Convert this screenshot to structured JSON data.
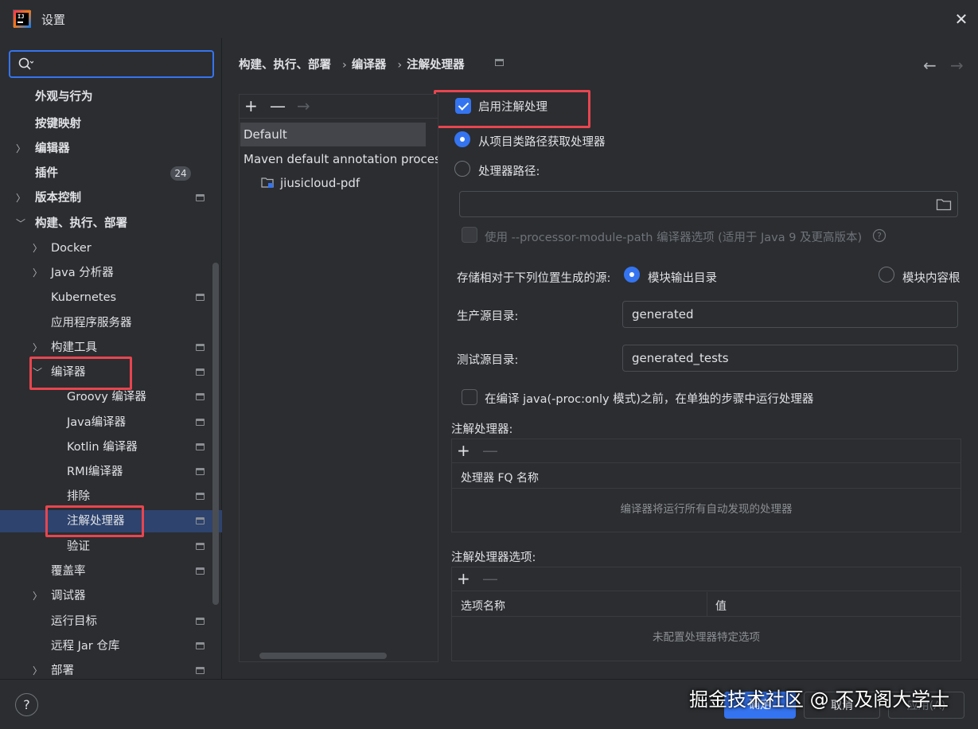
{
  "window": {
    "title": "设置",
    "close_icon": "close-icon"
  },
  "sidebar": {
    "search_placeholder": "",
    "items": [
      {
        "label": "外观与行为",
        "bold": true
      },
      {
        "label": "按键映射",
        "bold": true
      },
      {
        "label": "编辑器",
        "bold": true
      },
      {
        "label": "插件",
        "bold": true,
        "badge": "24"
      },
      {
        "label": "版本控制",
        "bold": true
      },
      {
        "label": "构建、执行、部署",
        "bold": true
      },
      {
        "label": "Docker"
      },
      {
        "label": "Java 分析器"
      },
      {
        "label": "Kubernetes"
      },
      {
        "label": "应用程序服务器"
      },
      {
        "label": "构建工具"
      },
      {
        "label": "编译器"
      },
      {
        "label": "Groovy 编译器"
      },
      {
        "label": "Java编译器"
      },
      {
        "label": "Kotlin 编译器"
      },
      {
        "label": "RMI编译器"
      },
      {
        "label": "排除"
      },
      {
        "label": "注解处理器",
        "selected": true
      },
      {
        "label": "验证"
      },
      {
        "label": "覆盖率"
      },
      {
        "label": "调试器"
      },
      {
        "label": "运行目标"
      },
      {
        "label": "远程 Jar 仓库"
      },
      {
        "label": "部署"
      }
    ]
  },
  "breadcrumb": [
    "构建、执行、部署",
    "编译器",
    "注解处理器"
  ],
  "profiles": {
    "default": "Default",
    "maven": "Maven default annotation processors profile",
    "module": "jiusicloud-pdf"
  },
  "form": {
    "enable_label": "启用注解处理",
    "enable_checked": true,
    "from_classpath_label": "从项目类路径获取处理器",
    "processor_path_label": "处理器路径:",
    "processor_path_value": "",
    "module_path_option": "使用 --processor-module-path 编译器选项 (适用于 Java 9 及更高版本)",
    "store_label": "存储相对于下列位置生成的源:",
    "store_option_output": "模块输出目录",
    "store_option_content_root": "模块内容根",
    "prod_dir_label": "生产源目录:",
    "prod_dir_value": "generated",
    "test_dir_label": "测试源目录:",
    "test_dir_value": "generated_tests",
    "separate_step_label": "在编译 java(-proc:only 模式)之前，在单独的步骤中运行处理器",
    "processors_title": "注解处理器:",
    "processors_col": "处理器 FQ 名称",
    "processors_empty": "编译器将运行所有自动发现的处理器",
    "options_title": "注解处理器选项:",
    "options_col_name": "选项名称",
    "options_col_value": "值",
    "options_empty": "未配置处理器特定选项"
  },
  "buttons": {
    "ok": "确定",
    "cancel": "取消",
    "apply": "应用(A)",
    "help": "?"
  },
  "watermark": "掘金技术社区 @ 不及阁大学士",
  "colors": {
    "accent": "#3574f0",
    "highlight": "#e8454f",
    "background": "#2b2d30"
  }
}
